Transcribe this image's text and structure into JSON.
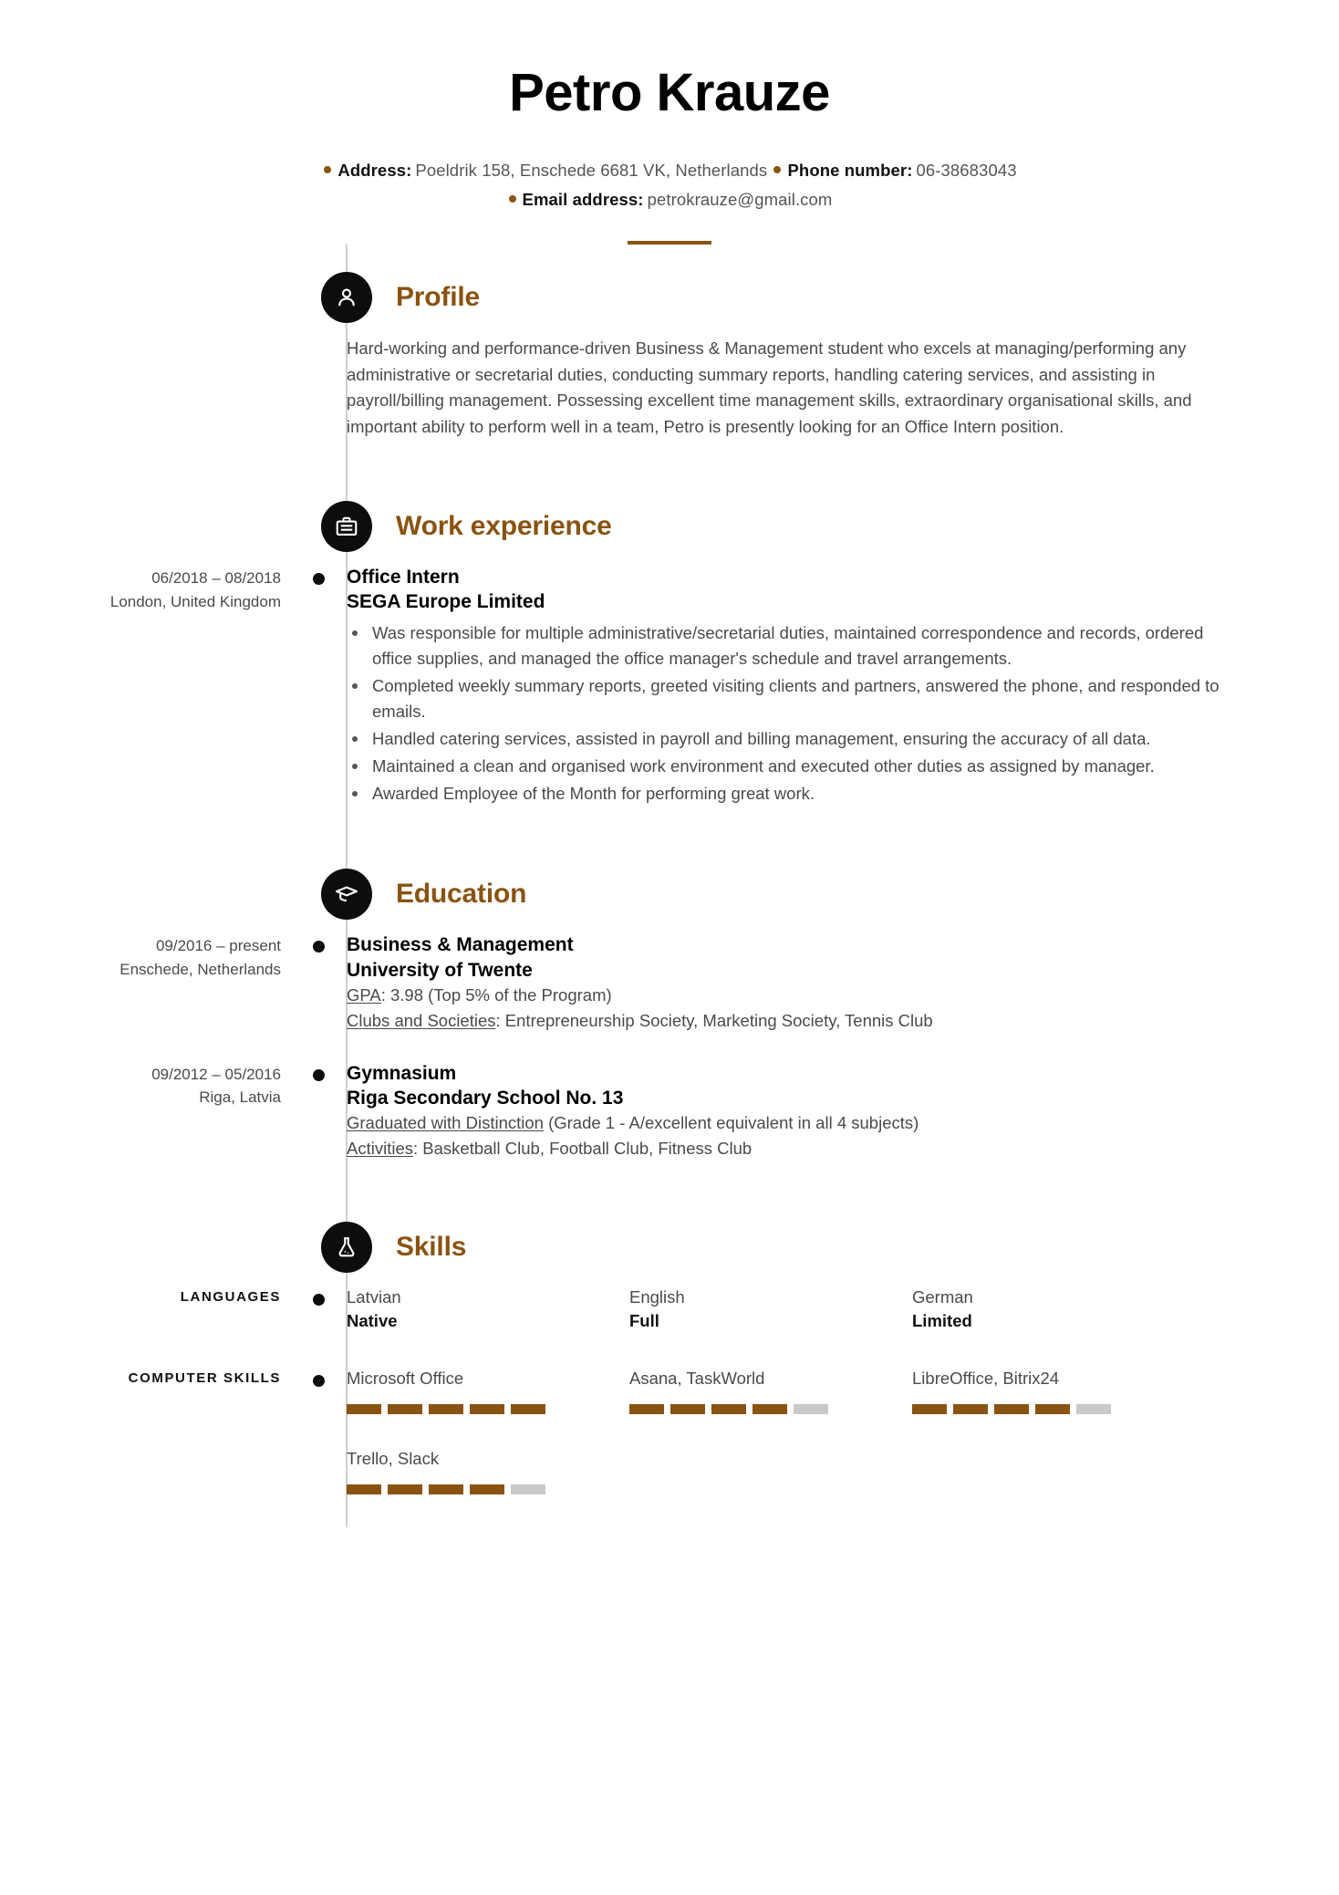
{
  "theme": {
    "accent": "#8a5311",
    "icon_bg": "#0d0d0d",
    "bar_empty": "#c9c9c9",
    "text": "#4a4a4a"
  },
  "header": {
    "name": "Petro Krauze",
    "contacts": [
      {
        "label": "Address:",
        "value": "Poeldrik 158, Enschede 6681 VK, Netherlands"
      },
      {
        "label": "Phone number:",
        "value": "06-38683043"
      },
      {
        "label": "Email address:",
        "value": "petrokrauze@gmail.com"
      }
    ]
  },
  "sections": {
    "profile": {
      "title": "Profile",
      "icon": "person-icon",
      "text": "Hard-working and performance-driven Business & Management student who excels at managing/performing any administrative or secretarial duties, conducting summary reports, handling catering services, and assisting in payroll/billing management. Possessing excellent time management skills, extraordinary organisational skills, and important ability to perform well in a team, Petro is presently looking for an Office Intern position."
    },
    "work": {
      "title": "Work experience",
      "icon": "briefcase-icon",
      "entries": [
        {
          "dates": "06/2018 – 08/2018",
          "location": "London, United Kingdom",
          "role": "Office Intern",
          "organisation": "SEGA Europe Limited",
          "duties": [
            "Was responsible for multiple administrative/secretarial duties, maintained correspondence and records, ordered office supplies, and managed the office manager's schedule and travel arrangements.",
            "Completed weekly summary reports, greeted visiting clients and partners, answered the phone, and responded to emails.",
            "Handled catering services, assisted in payroll and billing management, ensuring the accuracy of all data.",
            "Maintained a clean and organised work environment and executed other duties as assigned by manager.",
            "Awarded Employee of the Month for performing great work."
          ]
        }
      ]
    },
    "education": {
      "title": "Education",
      "icon": "graduation-cap-icon",
      "entries": [
        {
          "dates": "09/2016 – present",
          "location": "Enschede, Netherlands",
          "degree": "Business & Management",
          "institution": "University of Twente",
          "details": [
            {
              "label": "GPA",
              "value": ": 3.98 (Top 5% of the Program)"
            },
            {
              "label": "Clubs and Societies",
              "value": ": Entrepreneurship Society, Marketing Society, Tennis Club"
            }
          ]
        },
        {
          "dates": "09/2012 – 05/2016",
          "location": "Riga, Latvia",
          "degree": "Gymnasium",
          "institution": "Riga Secondary School No. 13",
          "details": [
            {
              "label": "Graduated with Distinction",
              "value": " (Grade 1 - A/excellent equivalent in all 4 subjects)"
            },
            {
              "label": "Activities",
              "value": ": Basketball Club, Football Club, Fitness Club"
            }
          ]
        }
      ]
    },
    "skills": {
      "title": "Skills",
      "icon": "flask-icon",
      "groups": [
        {
          "label": "LANGUAGES",
          "kind": "language",
          "items": [
            {
              "name": "Latvian",
              "level": "Native"
            },
            {
              "name": "English",
              "level": "Full"
            },
            {
              "name": "German",
              "level": "Limited"
            }
          ]
        },
        {
          "label": "COMPUTER SKILLS",
          "kind": "rating",
          "max": 5,
          "items": [
            {
              "name": "Microsoft Office",
              "filled": 5
            },
            {
              "name": "Asana, TaskWorld",
              "filled": 4
            },
            {
              "name": "LibreOffice, Bitrix24",
              "filled": 4
            },
            {
              "name": "Trello, Slack",
              "filled": 4
            }
          ]
        }
      ]
    }
  }
}
